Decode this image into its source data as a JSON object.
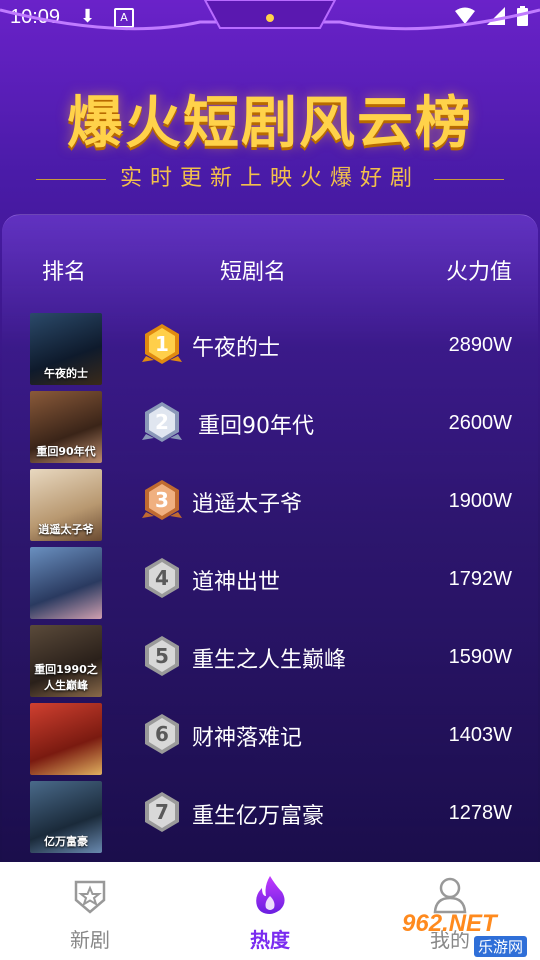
{
  "status_bar": {
    "time": "10:09",
    "download_icon": "download-icon",
    "app_icon": "A"
  },
  "hero": {
    "title": "爆火短剧风云榜",
    "subtitle": "实时更新上映火爆好剧"
  },
  "table": {
    "headers": {
      "rank": "排名",
      "name": "短剧名",
      "heat": "火力值"
    },
    "rows": [
      {
        "rank": "1",
        "title": "午夜的士",
        "heat": "2890W",
        "poster_text": "午夜的士",
        "medal": "gold"
      },
      {
        "rank": "2",
        "title": "重回90年代",
        "heat": "2600W",
        "poster_text": "重回90年代",
        "medal": "silver"
      },
      {
        "rank": "3",
        "title": "逍遥太子爷",
        "heat": "1900W",
        "poster_text": "逍遥太子爷",
        "medal": "bronze"
      },
      {
        "rank": "4",
        "title": "道神出世",
        "heat": "1792W",
        "poster_text": "",
        "medal": "plain"
      },
      {
        "rank": "5",
        "title": "重生之人生巅峰",
        "heat": "1590W",
        "poster_text": "重回1990之人生巅峰",
        "medal": "plain"
      },
      {
        "rank": "6",
        "title": "财神落难记",
        "heat": "1403W",
        "poster_text": "",
        "medal": "plain"
      },
      {
        "rank": "7",
        "title": "重生亿万富豪",
        "heat": "1278W",
        "poster_text": "亿万富豪",
        "medal": "plain"
      }
    ]
  },
  "nav": {
    "tabs": [
      {
        "label": "新剧",
        "icon": "star-shield-icon"
      },
      {
        "label": "热度",
        "icon": "flame-icon"
      },
      {
        "label": "我的",
        "icon": "user-icon"
      }
    ]
  },
  "watermark": {
    "text": "962.NET",
    "subtext": "乐游网"
  },
  "colors": {
    "accent": "#7b2cf0",
    "gold": "#ffd24a",
    "bg_top": "#6a22c9",
    "bg_bottom": "#1a0e4a"
  }
}
